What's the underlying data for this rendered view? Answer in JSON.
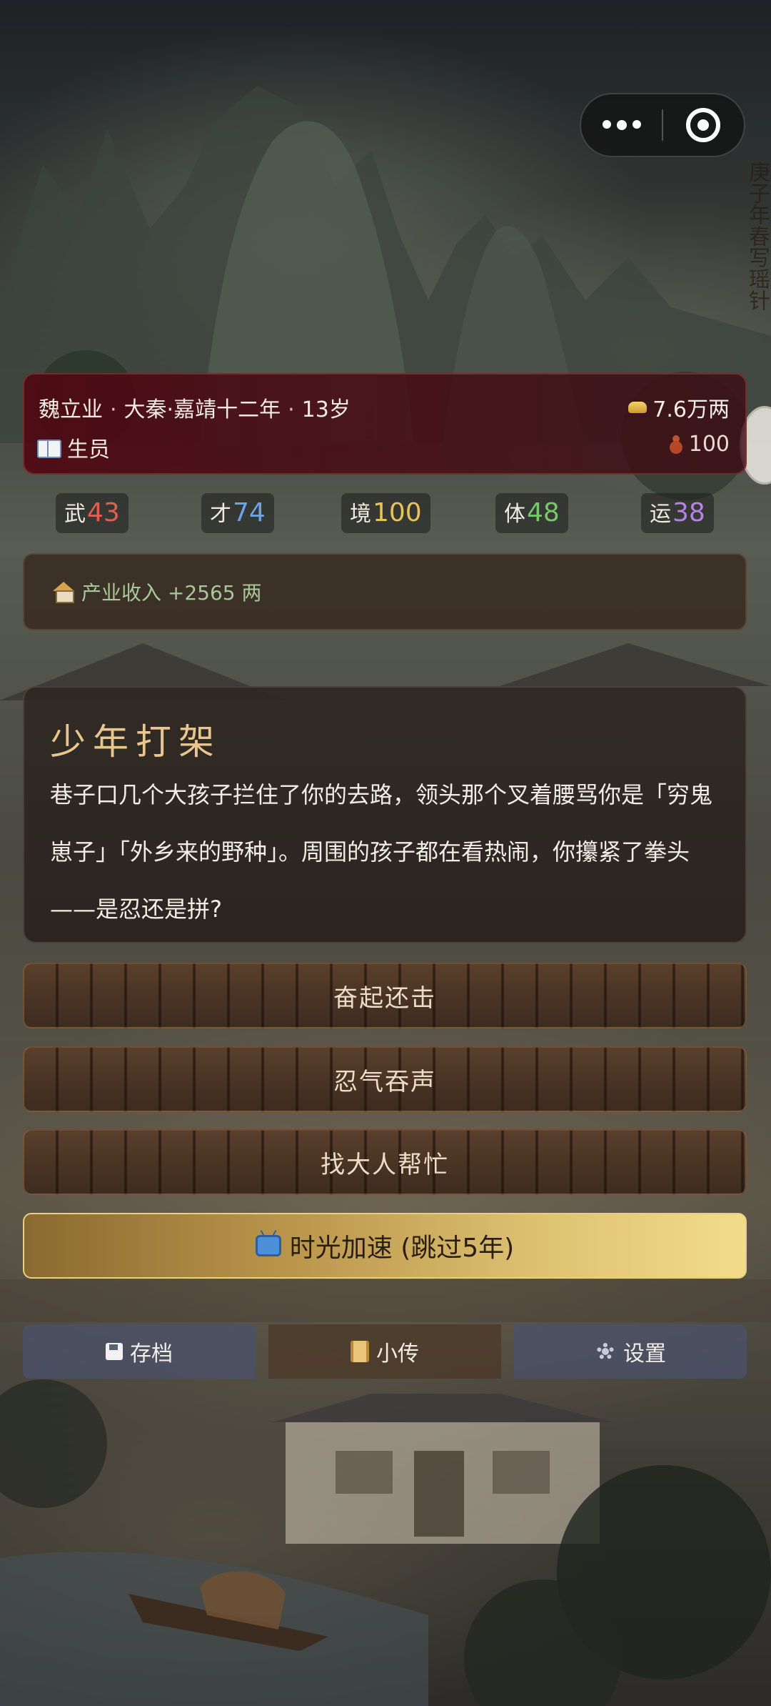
{
  "header": {
    "character_name": "魏立业",
    "era": "大秦·嘉靖十二年",
    "age": "13岁",
    "money": "7.6万两",
    "status": "生员",
    "health": "100",
    "separator": "·"
  },
  "stats": [
    {
      "label": "武",
      "value": "43",
      "color": "#e0604e"
    },
    {
      "label": "才",
      "value": "74",
      "color": "#6aa3e6"
    },
    {
      "label": "境",
      "value": "100",
      "color": "#e8c25a"
    },
    {
      "label": "体",
      "value": "48",
      "color": "#76c96a"
    },
    {
      "label": "运",
      "value": "38",
      "color": "#b383e6"
    }
  ],
  "income": {
    "text": "产业收入 +2565 两"
  },
  "event": {
    "title": "少年打架",
    "body": "巷子口几个大孩子拦住了你的去路，领头那个叉着腰骂你是「穷鬼崽子」「外乡来的野种」。周围的孩子都在看热闹，你攥紧了拳头——是忍还是拼?"
  },
  "choices": [
    {
      "label": "奋起还击"
    },
    {
      "label": "忍气吞声"
    },
    {
      "label": "找大人帮忙"
    }
  ],
  "speed_button": {
    "label": "时光加速 (跳过5年)"
  },
  "toolbar": {
    "save_label": "存档",
    "bio_label": "小传",
    "settings_label": "设置"
  },
  "background_calligraphy": "庚子年春写瑶针",
  "icons": {
    "money": "gold-ingot-icon",
    "status": "book-icon",
    "health": "gourd-icon",
    "income": "house-icon",
    "speed": "tv-icon",
    "save": "floppy-disk-icon",
    "bio": "scroll-icon",
    "settings": "gear-icon"
  }
}
